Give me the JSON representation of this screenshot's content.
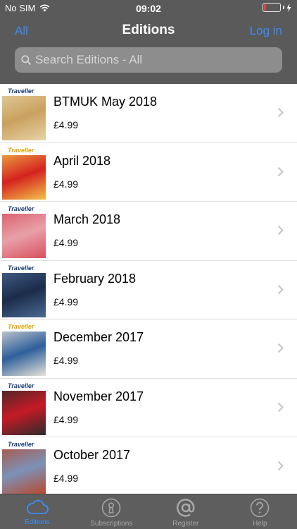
{
  "status_bar": {
    "carrier": "No SIM",
    "time": "09:02"
  },
  "navbar": {
    "left": "All",
    "title": "Editions",
    "right": "Log in"
  },
  "search": {
    "placeholder": "Search Editions - All"
  },
  "editions": [
    {
      "title": "BTMUK May 2018",
      "price": "£4.99",
      "cover_masthead": "Traveller",
      "cover_colors": [
        "#c9a15f",
        "#e8d3a6"
      ]
    },
    {
      "title": "April 2018",
      "price": "£4.99",
      "cover_masthead": "Traveller",
      "cover_colors": [
        "#d4231f",
        "#f3c24a"
      ]
    },
    {
      "title": "March 2018",
      "price": "£4.99",
      "cover_masthead": "Traveller",
      "cover_colors": [
        "#e8a0a8",
        "#d84f5c"
      ]
    },
    {
      "title": "February 2018",
      "price": "£4.99",
      "cover_masthead": "Traveller",
      "cover_colors": [
        "#1b2c4a",
        "#4a6a93"
      ]
    },
    {
      "title": "December 2017",
      "price": "£4.99",
      "cover_masthead": "Traveller",
      "cover_colors": [
        "#2f5f9c",
        "#e7e3d7"
      ]
    },
    {
      "title": "November 2017",
      "price": "£4.99",
      "cover_masthead": "Traveller",
      "cover_colors": [
        "#c51a25",
        "#2c2c2c"
      ]
    },
    {
      "title": "October 2017",
      "price": "£4.99",
      "cover_masthead": "Traveller",
      "cover_colors": [
        "#7b92b8",
        "#b84a2e"
      ]
    }
  ],
  "tabs": [
    {
      "label": "Editions",
      "icon": "cloud-icon",
      "active": true
    },
    {
      "label": "Subscriptions",
      "icon": "keyhole-icon",
      "active": false
    },
    {
      "label": "Register",
      "icon": "at-sign-icon",
      "active": false
    },
    {
      "label": "Help",
      "icon": "question-icon",
      "active": false
    }
  ],
  "colors": {
    "accent": "#3b8df5",
    "header_bg": "#5a5a5a",
    "tabbar_bg": "#5e5e5e",
    "battery_low": "#ff3b30"
  }
}
